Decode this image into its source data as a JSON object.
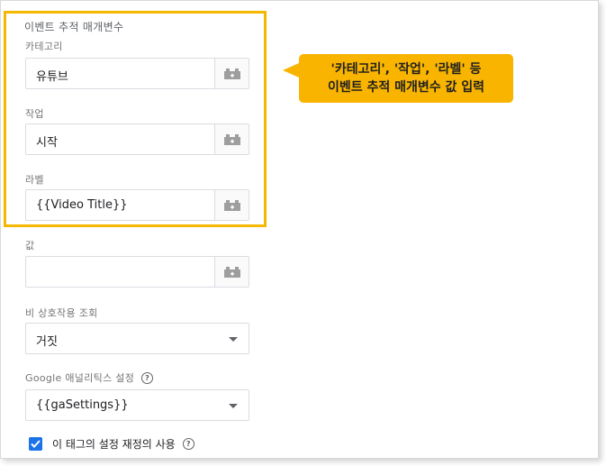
{
  "section_title": "이벤트 추적 매개변수",
  "fields": {
    "category": {
      "label": "카테고리",
      "value": "유튜브"
    },
    "action": {
      "label": "작업",
      "value": "시작"
    },
    "label": {
      "label": "라벨",
      "value": "{{Video Title}}"
    },
    "value": {
      "label": "값",
      "value": ""
    }
  },
  "non_interaction": {
    "label": "비 상호작용 조회",
    "selected": "거짓"
  },
  "ga_settings": {
    "label": "Google 애널리틱스 설정",
    "selected": "{{gaSettings}}"
  },
  "override": {
    "label": "이 태그의 설정 재정의 사용",
    "checked": true
  },
  "callout": {
    "line1": "'카테고리', '작업', '라벨' 등",
    "line2": "이벤트 추적 매개변수 값 입력"
  },
  "icons": {
    "variable": "variable-picker-icon",
    "help": "help-circle-icon",
    "dropdown": "chevron-down-icon",
    "check": "checkmark-icon"
  },
  "colors": {
    "highlight": "#f5b800",
    "callout": "#f9b400",
    "checkbox": "#1a73e8"
  }
}
